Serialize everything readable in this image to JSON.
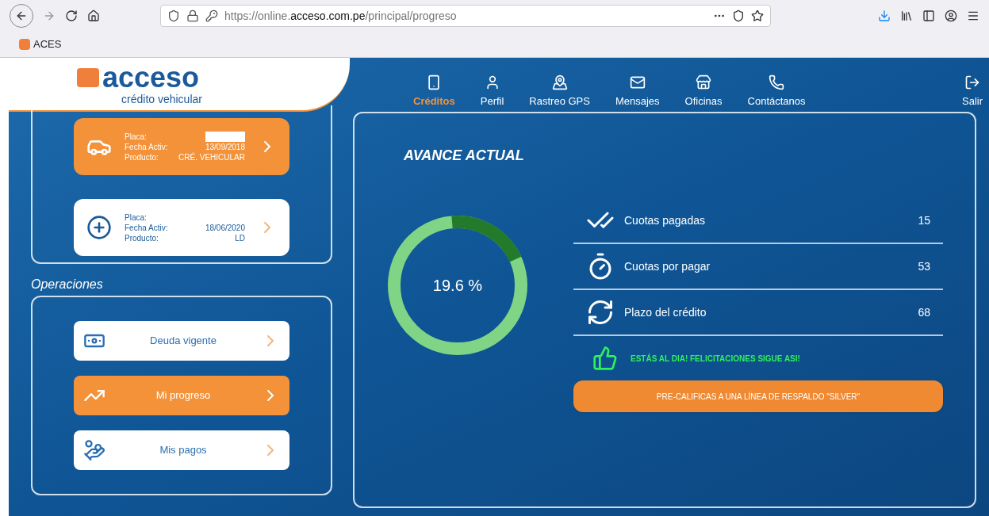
{
  "browser": {
    "url": "https://online.**acceso.com.pe**/principal/progreso",
    "bookmark": "ACES"
  },
  "logo": {
    "name": "acceso",
    "tagline": "crédito vehicular"
  },
  "nav": [
    {
      "label": "Créditos",
      "selected": true
    },
    {
      "label": "Perfil",
      "selected": false
    },
    {
      "label": "Rastreo GPS",
      "selected": false
    },
    {
      "label": "Mensajes",
      "selected": false
    },
    {
      "label": "Oficinas",
      "selected": false
    },
    {
      "label": "Contáctanos",
      "selected": false
    }
  ],
  "logout": {
    "label": "Salir"
  },
  "credits": [
    {
      "selected": true,
      "fields": [
        {
          "label": "Placa:",
          "redacted": true
        },
        {
          "label": "Fecha Activ:",
          "value": "13/09/2018"
        },
        {
          "label": "Producto:",
          "value": "CRÉ. VEHICULAR"
        }
      ]
    },
    {
      "selected": false,
      "fields": [
        {
          "label": "Placa:",
          "redacted": false
        },
        {
          "label": "Fecha Activ:",
          "value": "18/06/2020"
        },
        {
          "label": "Producto:",
          "value": "LD"
        }
      ]
    }
  ],
  "operations_title": "Operaciones",
  "operations": [
    {
      "label": "Deuda vigente",
      "selected": false
    },
    {
      "label": "Mi progreso",
      "selected": true
    },
    {
      "label": "Mis pagos",
      "selected": false
    }
  ],
  "progress": {
    "title": "AVANCE ACTUAL",
    "level": 0.196,
    "reading": "19.6 %"
  },
  "stats": [
    {
      "label": "Cuotas pagadas",
      "value": "15"
    },
    {
      "label": "Cuotas por pagar",
      "value": "53"
    },
    {
      "label": "Plazo del crédito",
      "value": "68"
    }
  ],
  "message": "ESTÁS AL DIA! FELICITACIONES SIGUE ASI!",
  "cta": "PRE-CALIFICAS A UNA LÍNEA DE RESPALDO \"SILVER\""
}
